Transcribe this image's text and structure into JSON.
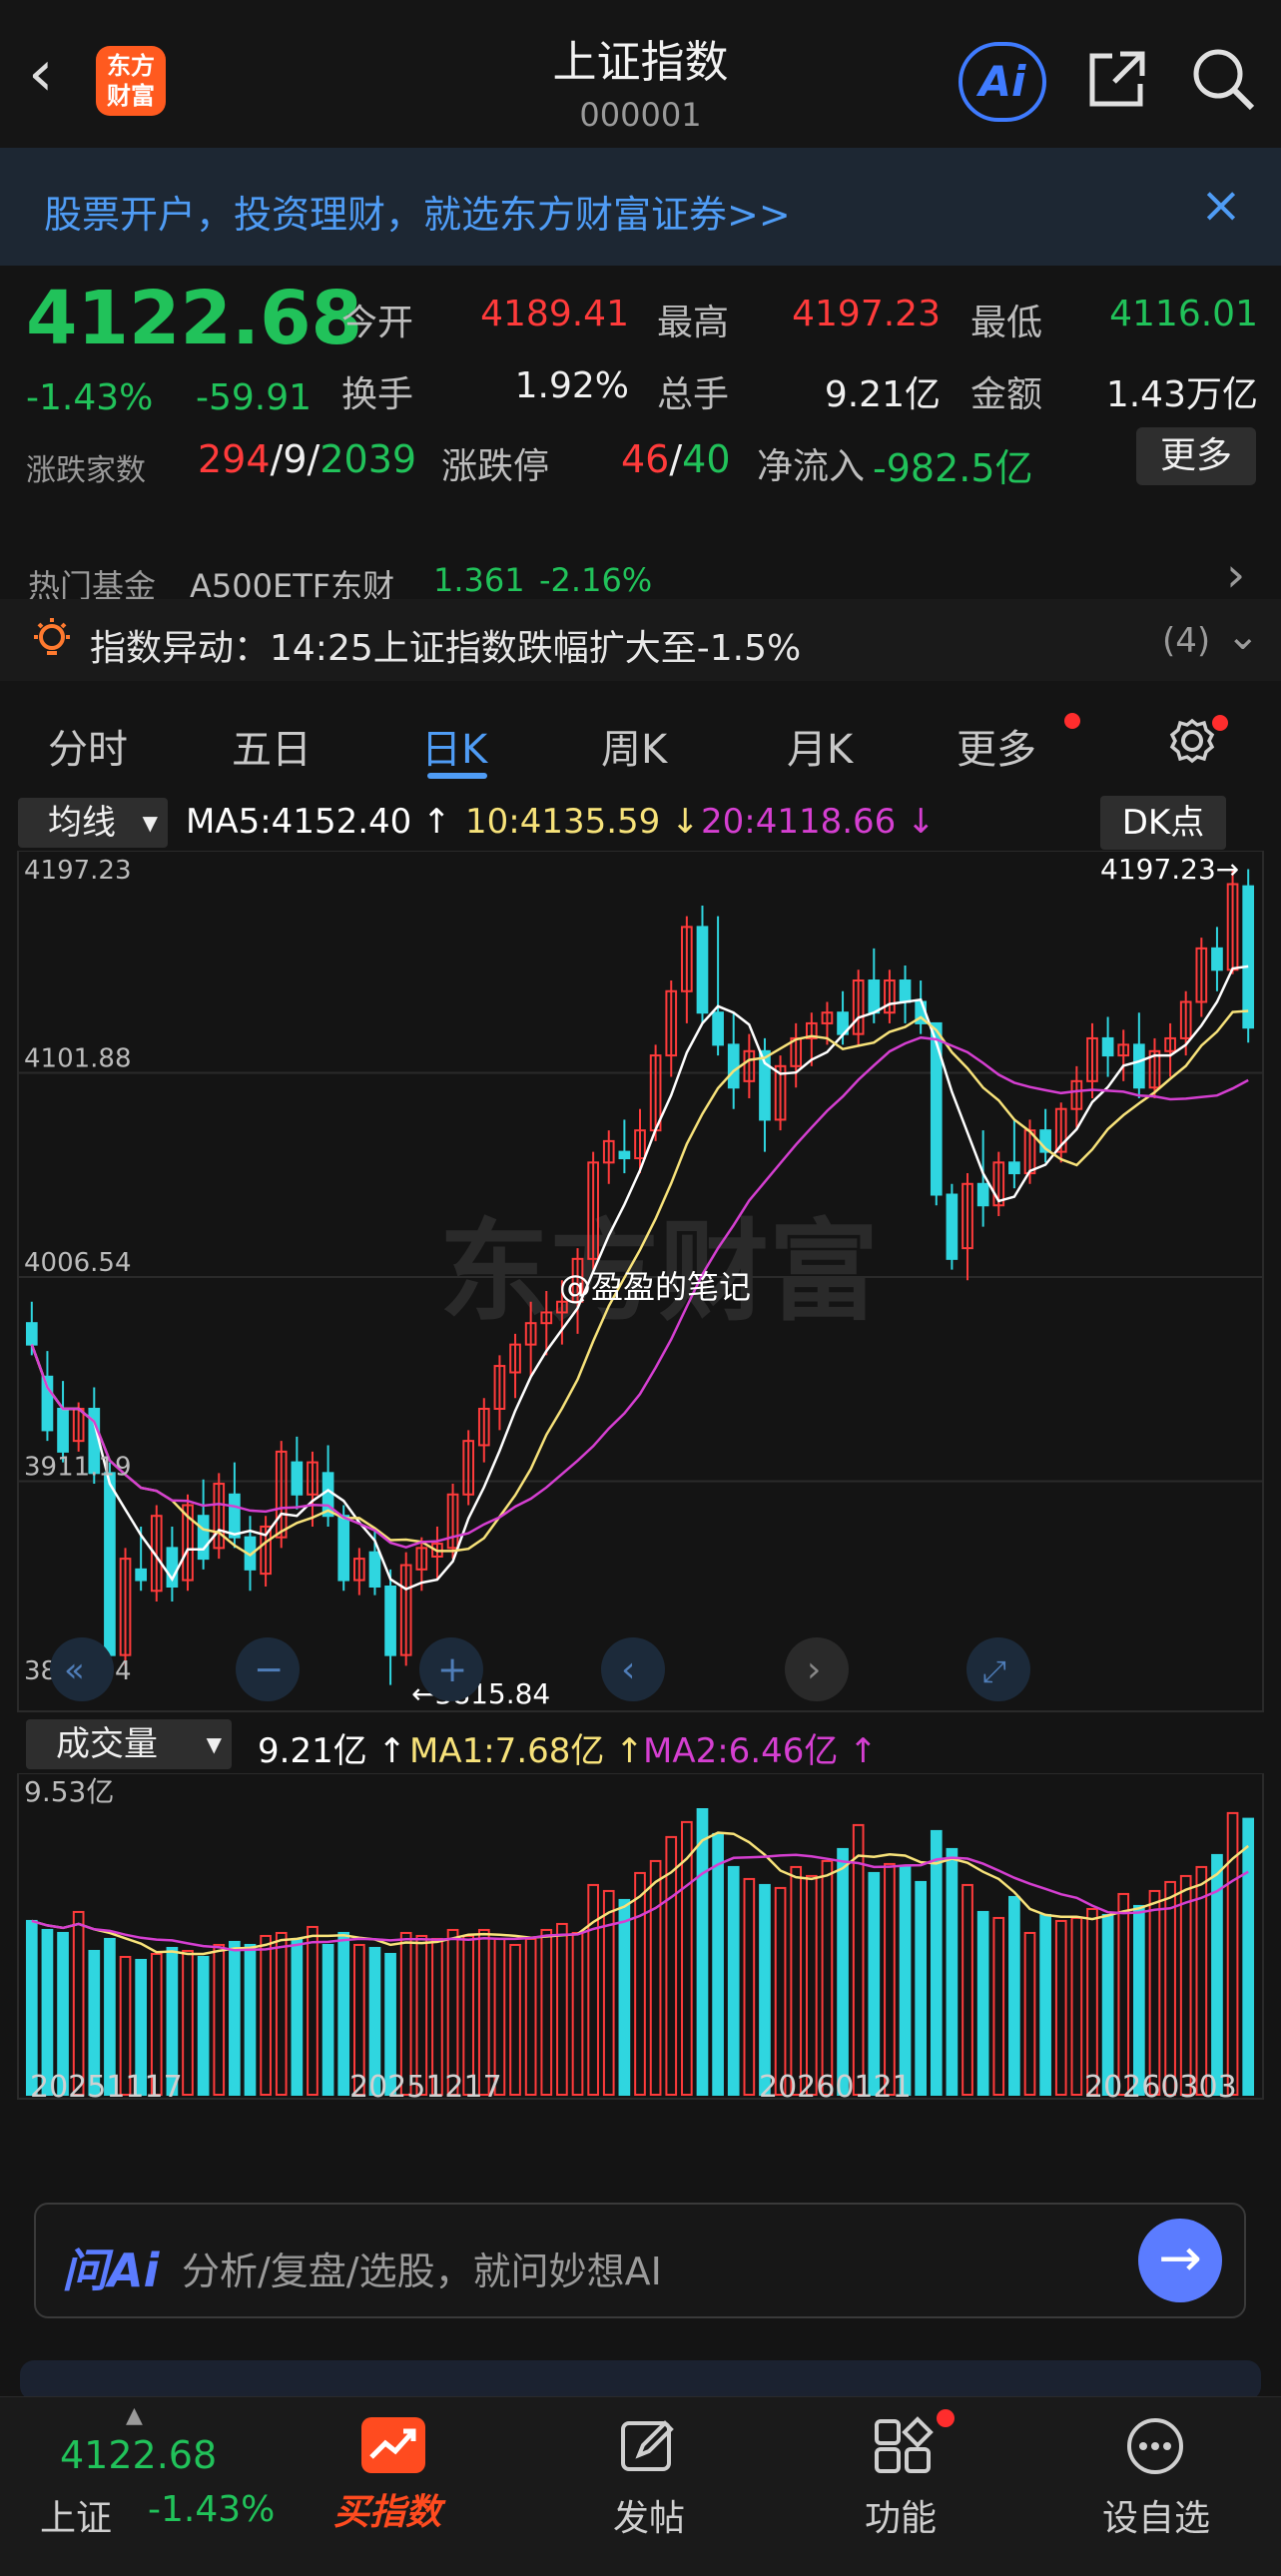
{
  "header": {
    "title": "上证指数",
    "code": "000001",
    "logo_text_1": "东方",
    "logo_text_2": "财富",
    "ai_label": "Ai"
  },
  "banner": {
    "text": "股票开户，投资理财，就选东方财富证券>>"
  },
  "quote": {
    "price": "4122.68",
    "change_pct": "-1.43%",
    "change_amt": "-59.91",
    "open_label": "今开",
    "open": "4189.41",
    "high_label": "最高",
    "high": "4197.23",
    "low_label": "最低",
    "low": "4116.01",
    "turnover_label": "换手",
    "turnover": "1.92%",
    "volume_label": "总手",
    "volume": "9.21亿",
    "amount_label": "金额",
    "amount": "1.43万亿",
    "breadth_label": "涨跌家数",
    "breadth_up": "294",
    "breadth_flat": "9",
    "breadth_down": "2039",
    "limit_label": "涨跌停",
    "limit_up": "46",
    "limit_down": "40",
    "netflow_label": "净流入",
    "netflow": "-982.5亿",
    "more_label": "更多",
    "sep": "/"
  },
  "fund_row": {
    "label": "热门基金",
    "name": "A500ETF东财",
    "price": "1.361",
    "change": "-2.16%"
  },
  "alert": {
    "text": "指数异动：14:25上证指数跌幅扩大至-1.5%",
    "count": "(4)"
  },
  "tabs": [
    "分时",
    "五日",
    "日K",
    "周K",
    "月K",
    "更多"
  ],
  "ma_row": {
    "selector": "均线",
    "ma5": "MA5:4152.40",
    "ma10": "10:4135.59",
    "ma20": "20:4118.66",
    "dk": "DK点"
  },
  "price_axis": [
    "4197.23",
    "4101.88",
    "4006.54",
    "3911.19",
    "3815.84"
  ],
  "high_marker": "4197.23→",
  "low_marker": "←3815.84",
  "watermark": "@盈盈的笔记",
  "vol_row": {
    "selector": "成交量",
    "vol": "9.21亿",
    "ma1": "MA1:7.68亿",
    "ma2": "MA2:6.46亿",
    "axis_max": "9.53亿"
  },
  "dates": [
    "20251117",
    "20251217",
    "20260121",
    "20260303"
  ],
  "ai_bar": {
    "logo": "问Ai",
    "placeholder": "分析/复盘/选股，就问妙想AI"
  },
  "bottom_nav": {
    "index_price": "4122.68",
    "index_name": "上证",
    "index_change": "-1.43%",
    "buy": "买指数",
    "post": "发帖",
    "func": "功能",
    "watch": "设自选"
  },
  "colors": {
    "up": "#ff3b3b",
    "down": "#21c25a",
    "candle_down": "#2fd6e0",
    "accent": "#4f9cf5",
    "ma5": "#ffffff",
    "ma10": "#f7e27a",
    "ma20": "#d53fd1"
  },
  "chart_data": {
    "type": "candlestick",
    "ylim": [
      3815.84,
      4197.23
    ],
    "candles_ohlc": [
      [
        3985,
        3995,
        3970,
        3975
      ],
      [
        3960,
        3972,
        3930,
        3935
      ],
      [
        3945,
        3958,
        3920,
        3925
      ],
      [
        3930,
        3948,
        3925,
        3945
      ],
      [
        3945,
        3955,
        3910,
        3915
      ],
      [
        3915,
        3920,
        3820,
        3830
      ],
      [
        3830,
        3880,
        3825,
        3875
      ],
      [
        3870,
        3890,
        3860,
        3865
      ],
      [
        3860,
        3900,
        3855,
        3895
      ],
      [
        3880,
        3890,
        3855,
        3862
      ],
      [
        3865,
        3905,
        3860,
        3900
      ],
      [
        3895,
        3912,
        3870,
        3875
      ],
      [
        3880,
        3915,
        3875,
        3910
      ],
      [
        3905,
        3920,
        3880,
        3885
      ],
      [
        3885,
        3895,
        3860,
        3870
      ],
      [
        3868,
        3895,
        3862,
        3890
      ],
      [
        3885,
        3930,
        3880,
        3925
      ],
      [
        3920,
        3932,
        3898,
        3905
      ],
      [
        3905,
        3925,
        3890,
        3920
      ],
      [
        3915,
        3928,
        3890,
        3895
      ],
      [
        3895,
        3900,
        3860,
        3865
      ],
      [
        3865,
        3880,
        3858,
        3875
      ],
      [
        3878,
        3888,
        3858,
        3862
      ],
      [
        3862,
        3870,
        3816,
        3830
      ],
      [
        3830,
        3878,
        3825,
        3872
      ],
      [
        3870,
        3885,
        3860,
        3880
      ],
      [
        3876,
        3890,
        3865,
        3882
      ],
      [
        3880,
        3910,
        3875,
        3905
      ],
      [
        3905,
        3935,
        3900,
        3930
      ],
      [
        3928,
        3950,
        3920,
        3945
      ],
      [
        3945,
        3970,
        3935,
        3965
      ],
      [
        3962,
        3980,
        3950,
        3975
      ],
      [
        3975,
        3995,
        3960,
        3985
      ],
      [
        3985,
        4000,
        3970,
        3990
      ],
      [
        3990,
        4005,
        3975,
        3995
      ],
      [
        3995,
        4020,
        3980,
        4015
      ],
      [
        4015,
        4065,
        4010,
        4060
      ],
      [
        4060,
        4075,
        4050,
        4070
      ],
      [
        4065,
        4080,
        4055,
        4062
      ],
      [
        4062,
        4085,
        4055,
        4075
      ],
      [
        4075,
        4115,
        4070,
        4110
      ],
      [
        4110,
        4145,
        4100,
        4140
      ],
      [
        4140,
        4175,
        4125,
        4170
      ],
      [
        4170,
        4180,
        4125,
        4130
      ],
      [
        4130,
        4175,
        4110,
        4115
      ],
      [
        4115,
        4130,
        4085,
        4095
      ],
      [
        4098,
        4120,
        4090,
        4112
      ],
      [
        4112,
        4118,
        4065,
        4080
      ],
      [
        4080,
        4110,
        4075,
        4105
      ],
      [
        4105,
        4125,
        4095,
        4118
      ],
      [
        4118,
        4130,
        4105,
        4125
      ],
      [
        4125,
        4135,
        4115,
        4130
      ],
      [
        4130,
        4140,
        4115,
        4120
      ],
      [
        4120,
        4150,
        4115,
        4145
      ],
      [
        4145,
        4160,
        4125,
        4130
      ],
      [
        4130,
        4150,
        4125,
        4145
      ],
      [
        4145,
        4152,
        4125,
        4135
      ],
      [
        4135,
        4145,
        4120,
        4125
      ],
      [
        4125,
        4060,
        4040,
        4045
      ],
      [
        4045,
        4050,
        4010,
        4015
      ],
      [
        4020,
        4055,
        4005,
        4050
      ],
      [
        4050,
        4075,
        4030,
        4040
      ],
      [
        4040,
        4065,
        4035,
        4060
      ],
      [
        4060,
        4080,
        4048,
        4055
      ],
      [
        4055,
        4080,
        4050,
        4075
      ],
      [
        4075,
        4085,
        4060,
        4065
      ],
      [
        4065,
        4088,
        4060,
        4085
      ],
      [
        4085,
        4105,
        4075,
        4098
      ],
      [
        4098,
        4125,
        4090,
        4118
      ],
      [
        4118,
        4128,
        4100,
        4110
      ],
      [
        4110,
        4122,
        4098,
        4115
      ],
      [
        4115,
        4130,
        4090,
        4095
      ],
      [
        4095,
        4118,
        4090,
        4112
      ],
      [
        4112,
        4125,
        4100,
        4118
      ],
      [
        4118,
        4140,
        4110,
        4135
      ],
      [
        4135,
        4165,
        4128,
        4160
      ],
      [
        4160,
        4170,
        4140,
        4150
      ],
      [
        4150,
        4197,
        4148,
        4190
      ],
      [
        4189,
        4197,
        4116,
        4123
      ]
    ],
    "volume": [
      5.8,
      5.5,
      5.4,
      6.1,
      4.8,
      5.2,
      4.6,
      4.5,
      4.7,
      4.9,
      4.8,
      4.6,
      5.0,
      5.1,
      5.0,
      5.3,
      5.4,
      5.2,
      5.6,
      5.0,
      5.4,
      5.0,
      4.9,
      4.7,
      5.4,
      5.3,
      5.2,
      5.5,
      5.3,
      5.5,
      5.2,
      5.0,
      5.2,
      5.5,
      5.7,
      5.4,
      7.0,
      6.8,
      6.5,
      7.4,
      7.8,
      8.6,
      9.1,
      9.53,
      8.7,
      7.6,
      7.2,
      7.0,
      6.9,
      7.6,
      7.3,
      7.8,
      8.2,
      9.0,
      7.4,
      7.7,
      7.6,
      7.1,
      8.8,
      8.2,
      7.0,
      6.1,
      5.9,
      6.6,
      5.4,
      6.0,
      5.8,
      5.9,
      6.2,
      6.0,
      6.7,
      6.3,
      6.8,
      7.1,
      7.3,
      7.6,
      8.0,
      9.4,
      9.21
    ]
  }
}
